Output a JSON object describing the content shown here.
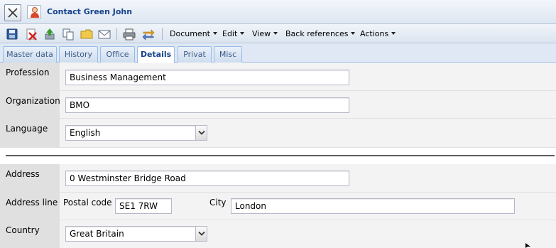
{
  "window": {
    "title": "Contact Green John"
  },
  "toolbar": {
    "icons": [
      "save-icon",
      "delete-icon",
      "upload-icon",
      "copy-icon",
      "folder-icon",
      "mail-icon",
      "print-icon",
      "exchange-icon"
    ],
    "menus": {
      "document": "Document",
      "edit": "Edit",
      "view": "View",
      "back_references": "Back references",
      "actions": "Actions"
    }
  },
  "tabs": {
    "master_data": "Master data",
    "history": "History",
    "office": "Office",
    "details": "Details",
    "privat": "Privat",
    "misc": "Misc"
  },
  "form": {
    "profession": {
      "label": "Profession",
      "value": "Business Management"
    },
    "organization": {
      "label": "Organization",
      "value": "BMO"
    },
    "language": {
      "label": "Language",
      "value": "English"
    },
    "address": {
      "label": "Address",
      "value": "0 Westminster Bridge Road"
    },
    "address_line": {
      "label": "Address line",
      "postal_code_label": "Postal code",
      "postal_code_value": "SE1 7RW",
      "city_label": "City",
      "city_value": "London"
    },
    "country": {
      "label": "Country",
      "value": "Great Britain"
    }
  },
  "colors": {
    "title_text": "#15428b",
    "tab_border": "#99bbe8",
    "label_bg": "#e0e0e0"
  }
}
